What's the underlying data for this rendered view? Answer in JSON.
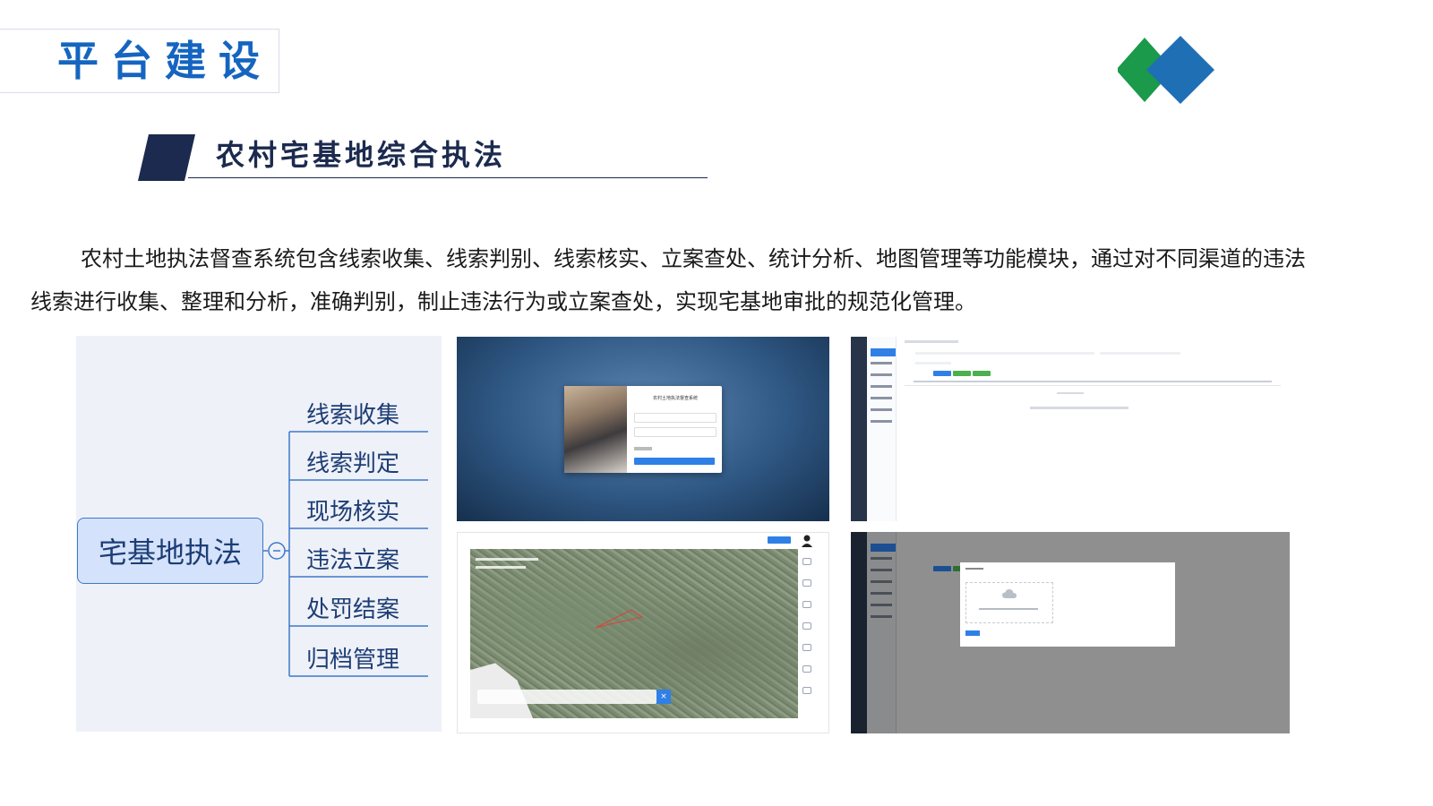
{
  "header": {
    "title": "平台建设",
    "logo_icon": "diamond-logo-icon",
    "logo_colors": [
      "#1a9a4a",
      "#1f6fb5"
    ]
  },
  "section": {
    "title": "农村宅基地综合执法",
    "accent_color": "#1b2a4e"
  },
  "description": "农村土地执法督查系统包含线索收集、线索判别、线索核实、立案查处、统计分析、地图管理等功能模块，通过对不同渠道的违法线索进行收集、整理和分析，准确判别，制止违法行为或立案查处，实现宅基地审批的规范化管理。",
  "mindmap": {
    "root": "宅基地执法",
    "branches": [
      "线索收集",
      "线索判定",
      "现场核实",
      "违法立案",
      "处罚结案",
      "归档管理"
    ]
  },
  "screenshots": {
    "login": {
      "title": "农村土地执法督查系统"
    },
    "map": {
      "close_label": "×"
    }
  }
}
